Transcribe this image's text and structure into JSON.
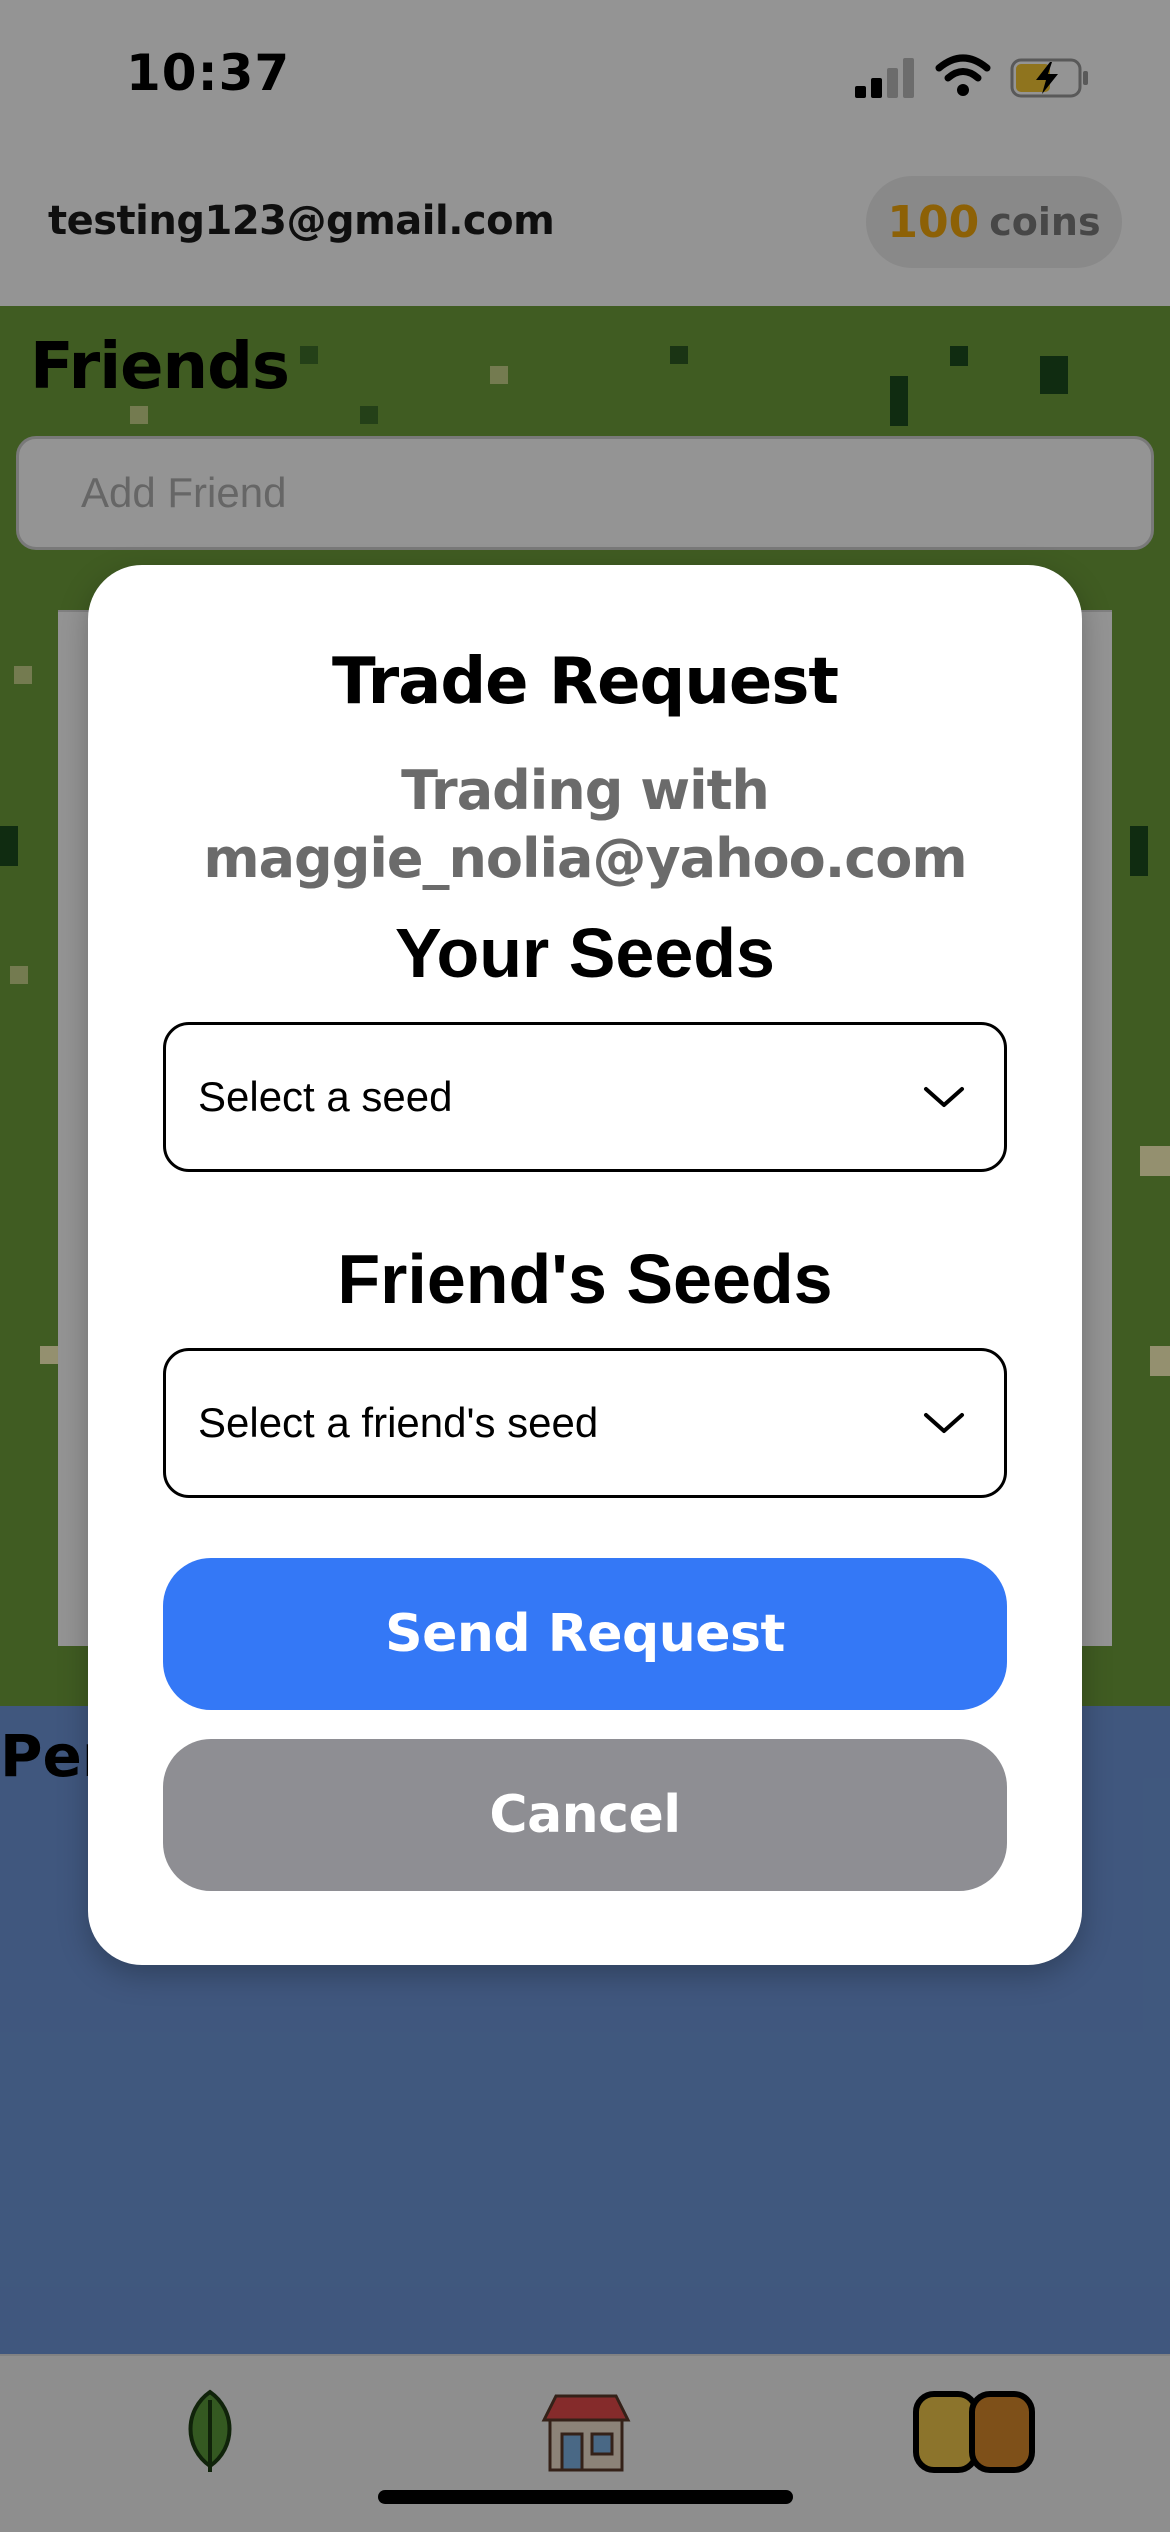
{
  "status_bar": {
    "time": "10:37"
  },
  "header": {
    "email": "testing123@gmail.com",
    "coins_amount": "100",
    "coins_label": "coins"
  },
  "friends": {
    "title": "Friends",
    "add_placeholder": "Add Friend"
  },
  "pending": {
    "title": "Pen"
  },
  "tabs": [
    {
      "icon": "leaf-icon"
    },
    {
      "icon": "shop-icon"
    },
    {
      "icon": "friends-icon"
    }
  ],
  "modal": {
    "title": "Trade Request",
    "subtitle_line1": "Trading with",
    "subtitle_line2": "maggie_nolia@yahoo.com",
    "your_seeds_title": "Your Seeds",
    "your_seed_select": "Select a seed",
    "friend_seeds_title": "Friend's Seeds",
    "friend_seed_select": "Select a friend's seed",
    "send_label": "Send Request",
    "cancel_label": "Cancel"
  },
  "colors": {
    "accent": "#3478f6",
    "cancel": "#8e8e93",
    "coins": "#f3a80c",
    "grass": "#6f9f3b",
    "water": "#6e97d9"
  }
}
